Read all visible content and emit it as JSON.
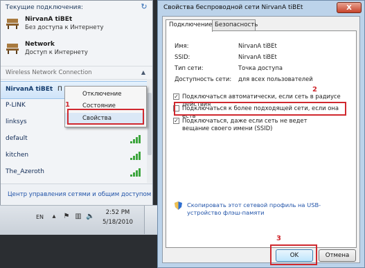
{
  "flyout": {
    "header": "Текущие подключения:",
    "connections": [
      {
        "name": "NirvanA tiBEt",
        "status": "Без доступа к Интернету"
      },
      {
        "name": "Network",
        "status": "Доступ к Интернету"
      }
    ],
    "section_label": "Wireless Network Connection",
    "networks": [
      {
        "name": "NirvanA tiBEt",
        "truncated": "П"
      },
      {
        "name": "P-LINK"
      },
      {
        "name": "linksys"
      },
      {
        "name": "default"
      },
      {
        "name": "kitchen"
      },
      {
        "name": "The_Azeroth"
      }
    ],
    "footer_link": "Центр управления сетями и общим доступом"
  },
  "context_menu": {
    "items": [
      "Отключение",
      "Состояние",
      "Свойства"
    ],
    "highlighted_index": 2
  },
  "annotations": {
    "step1": "1",
    "step2": "2",
    "step3": "3",
    "color": "#d0282e"
  },
  "taskbar": {
    "language": "EN",
    "time": "2:52 PM",
    "date": "5/18/2010"
  },
  "dialog": {
    "title": "Свойства беспроводной сети NirvanA tiBEt",
    "close_label": "X",
    "tabs": [
      "Подключение",
      "Безопасность"
    ],
    "active_tab": 0,
    "fields": [
      {
        "key": "Имя:",
        "value": "NirvanA tiBEt"
      },
      {
        "key": "SSID:",
        "value": "NirvanA tiBEt"
      },
      {
        "key": "Тип сети:",
        "value": "Точка доступа"
      },
      {
        "key": "Доступность сети:",
        "value": "для всех пользователей"
      }
    ],
    "checkboxes": [
      {
        "label": "Подключаться автоматически, если сеть в радиусе действия",
        "checked": true
      },
      {
        "label": "Подключаться к более подходящей сети, если она есть",
        "checked": false
      },
      {
        "label": "Подключаться, даже если сеть не ведет вещание своего имени (SSID)",
        "checked": true
      }
    ],
    "copy_link": "Скопировать этот сетевой профиль на USB-устройство флэш-памяти",
    "ok_label": "OK",
    "cancel_label": "Отмена"
  },
  "colors": {
    "accent_link": "#1f52a8",
    "selection": "#cfe4f9",
    "signal": "#3da53d"
  }
}
